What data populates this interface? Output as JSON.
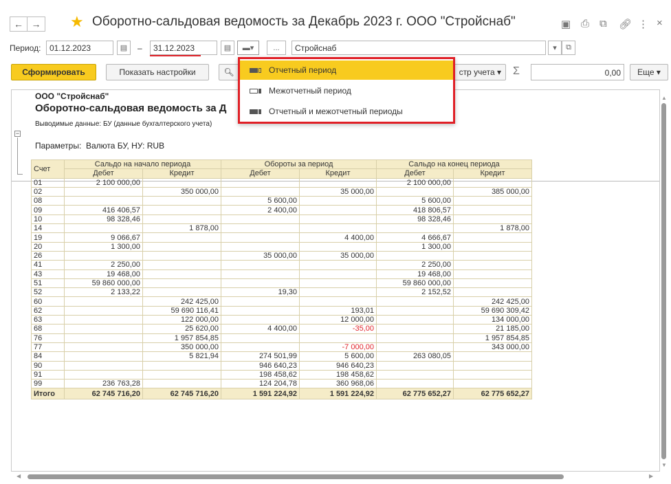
{
  "window": {
    "title": "Оборотно-сальдовая ведомость за Декабрь 2023 г. ООО \"Стройснаб\"",
    "close": "×"
  },
  "period": {
    "label": "Период:",
    "from": "01.12.2023",
    "dash": "–",
    "to": "31.12.2023",
    "ellipsis": "...",
    "organization": "Стройснаб"
  },
  "toolbar": {
    "generate": "Сформировать",
    "show_settings": "Показать настройки",
    "register": "стр учета",
    "sigma": "Σ",
    "sum_value": "0,00",
    "more": "Еще"
  },
  "period_menu": {
    "items": [
      {
        "label": "Отчетный период",
        "selected": true
      },
      {
        "label": "Межотчетный период",
        "selected": false
      },
      {
        "label": "Отчетный и межотчетный периоды",
        "selected": false
      }
    ]
  },
  "report": {
    "company": "ООО \"Стройснаб\"",
    "title": "Оборотно-сальдовая ведомость за Д",
    "output_info": "Выводимые данные: БУ (данные бухгалтерского учета)",
    "params_label": "Параметры:",
    "params_value": "Валюта БУ, НУ: RUB",
    "headers": {
      "account": "Счет",
      "opening": "Сальдо на начало периода",
      "turnover": "Обороты за период",
      "closing": "Сальдо на конец периода",
      "debit": "Дебет",
      "credit": "Кредит"
    },
    "rows": [
      [
        "01",
        "2 100 000,00",
        "",
        "",
        "",
        "2 100 000,00",
        ""
      ],
      [
        "02",
        "",
        "350 000,00",
        "",
        "35 000,00",
        "",
        "385 000,00"
      ],
      [
        "08",
        "",
        "",
        "5 600,00",
        "",
        "5 600,00",
        ""
      ],
      [
        "09",
        "416 406,57",
        "",
        "2 400,00",
        "",
        "418 806,57",
        ""
      ],
      [
        "10",
        "98 328,46",
        "",
        "",
        "",
        "98 328,46",
        ""
      ],
      [
        "14",
        "",
        "1 878,00",
        "",
        "",
        "",
        "1 878,00"
      ],
      [
        "19",
        "9 066,67",
        "",
        "",
        "4 400,00",
        "4 666,67",
        ""
      ],
      [
        "20",
        "1 300,00",
        "",
        "",
        "",
        "1 300,00",
        ""
      ],
      [
        "26",
        "",
        "",
        "35 000,00",
        "35 000,00",
        "",
        ""
      ],
      [
        "41",
        "2 250,00",
        "",
        "",
        "",
        "2 250,00",
        ""
      ],
      [
        "43",
        "19 468,00",
        "",
        "",
        "",
        "19 468,00",
        ""
      ],
      [
        "51",
        "59 860 000,00",
        "",
        "",
        "",
        "59 860 000,00",
        ""
      ],
      [
        "52",
        "2 133,22",
        "",
        "19,30",
        "",
        "2 152,52",
        ""
      ],
      [
        "60",
        "",
        "242 425,00",
        "",
        "",
        "",
        "242 425,00"
      ],
      [
        "62",
        "",
        "59 690 116,41",
        "",
        "193,01",
        "",
        "59 690 309,42"
      ],
      [
        "63",
        "",
        "122 000,00",
        "",
        "12 000,00",
        "",
        "134 000,00"
      ],
      [
        "68",
        "",
        "25 620,00",
        "4 400,00",
        "-35,00",
        "",
        "21 185,00"
      ],
      [
        "76",
        "",
        "1 957 854,85",
        "",
        "",
        "",
        "1 957 854,85"
      ],
      [
        "77",
        "",
        "350 000,00",
        "",
        "-7 000,00",
        "",
        "343 000,00"
      ],
      [
        "84",
        "",
        "5 821,94",
        "274 501,99",
        "5 600,00",
        "263 080,05",
        ""
      ],
      [
        "90",
        "",
        "",
        "946 640,23",
        "946 640,23",
        "",
        ""
      ],
      [
        "91",
        "",
        "",
        "198 458,62",
        "198 458,62",
        "",
        ""
      ],
      [
        "99",
        "236 763,28",
        "",
        "124 204,78",
        "360 968,06",
        "",
        ""
      ]
    ],
    "total": [
      "Итого",
      "62 745 716,20",
      "62 745 716,20",
      "1 591 224,92",
      "1 591 224,92",
      "62 775 652,27",
      "62 775 652,27"
    ]
  },
  "colors": {
    "accent": "#f8cb1f",
    "highlight_border": "#e01f26",
    "negative": "#e0242a",
    "header_bg": "#f5ecc8"
  }
}
